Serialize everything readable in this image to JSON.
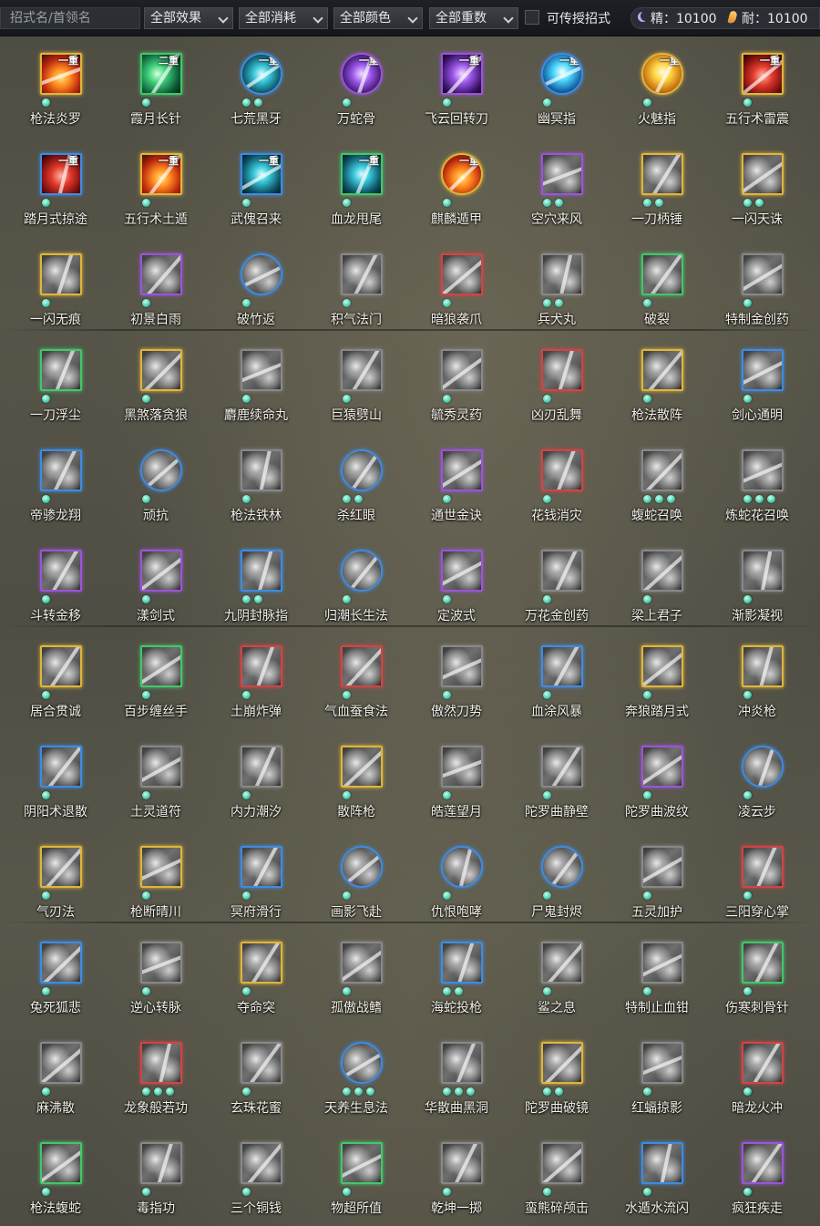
{
  "filters": {
    "search_placeholder": "招式名/首领名",
    "effect": "全部效果",
    "cost": "全部消耗",
    "color": "全部颜色",
    "weight": "全部重数",
    "transferable_label": "可传授招式"
  },
  "stats": {
    "jing_label": "精：10100",
    "nai_label": "耐：10100"
  },
  "skills": [
    {
      "name": "枪法炎罗",
      "tier": "一重",
      "border": "#e0b53a",
      "art": "fire",
      "dots": 1
    },
    {
      "name": "霞月长针",
      "tier": "二重",
      "border": "#44c66a",
      "art": "green",
      "dots": 1
    },
    {
      "name": "七荒黑牙",
      "tier": "一重",
      "border": "#3f8be0",
      "art": "teal",
      "dots": 2,
      "round": true
    },
    {
      "name": "万蛇骨",
      "tier": "一重",
      "border": "#9a55d6",
      "art": "purple",
      "dots": 1,
      "round": true
    },
    {
      "name": "飞云回转刀",
      "tier": "一重",
      "border": "#9a55d6",
      "art": "purple",
      "dots": 1
    },
    {
      "name": "幽冥指",
      "tier": "一重",
      "border": "#3f8be0",
      "art": "cyan",
      "dots": 1,
      "round": true
    },
    {
      "name": "火魅指",
      "tier": "一重",
      "border": "#e0b53a",
      "art": "gold",
      "dots": 1,
      "round": true
    },
    {
      "name": "五行术雷震",
      "tier": "一重",
      "border": "#e0b53a",
      "art": "red",
      "dots": 1
    },
    {
      "name": "踏月式掠途",
      "tier": "一重",
      "border": "#3f8be0",
      "art": "red",
      "dots": 1
    },
    {
      "name": "五行术土遁",
      "tier": "一重",
      "border": "#e0b53a",
      "art": "fire",
      "dots": 1
    },
    {
      "name": "武傀召来",
      "tier": "一重",
      "border": "#3f8be0",
      "art": "teal",
      "dots": 1
    },
    {
      "name": "血龙甩尾",
      "tier": "一重",
      "border": "#44c66a",
      "art": "teal",
      "dots": 1
    },
    {
      "name": "麒麟遁甲",
      "tier": "一重",
      "border": "#e0b53a",
      "art": "fire",
      "dots": 1,
      "round": true
    },
    {
      "name": "空穴来风",
      "tier": "",
      "border": "#9a55d6",
      "art": "gray",
      "dots": 2
    },
    {
      "name": "一刀柄锤",
      "tier": "",
      "border": "#e0b53a",
      "art": "gray",
      "dots": 2
    },
    {
      "name": "一闪天诛",
      "tier": "",
      "border": "#e0b53a",
      "art": "gray",
      "dots": 2
    },
    {
      "name": "一闪无痕",
      "tier": "",
      "border": "#e0b53a",
      "art": "gray",
      "dots": 1
    },
    {
      "name": "初景白雨",
      "tier": "",
      "border": "#9a55d6",
      "art": "gray",
      "dots": 1
    },
    {
      "name": "破竹返",
      "tier": "",
      "border": "#3f8be0",
      "art": "gray",
      "dots": 1,
      "round": true
    },
    {
      "name": "积气法门",
      "tier": "",
      "border": "#888888",
      "art": "gray",
      "dots": 1
    },
    {
      "name": "暗狼袭爪",
      "tier": "",
      "border": "#d04545",
      "art": "gray",
      "dots": 1
    },
    {
      "name": "兵犬丸",
      "tier": "",
      "border": "#888888",
      "art": "gray",
      "dots": 2
    },
    {
      "name": "破裂",
      "tier": "",
      "border": "#44c66a",
      "art": "gray",
      "dots": 1
    },
    {
      "name": "特制金创药",
      "tier": "",
      "border": "#888888",
      "art": "gray",
      "dots": 1
    },
    {
      "name": "一刀浮尘",
      "tier": "",
      "border": "#44c66a",
      "art": "gray",
      "dots": 1
    },
    {
      "name": "黑煞落贪狼",
      "tier": "",
      "border": "#e0b53a",
      "art": "gray",
      "dots": 1
    },
    {
      "name": "麝鹿续命丸",
      "tier": "",
      "border": "#888888",
      "art": "gray",
      "dots": 1
    },
    {
      "name": "巨猿劈山",
      "tier": "",
      "border": "#888888",
      "art": "gray",
      "dots": 1
    },
    {
      "name": "毓秀灵药",
      "tier": "",
      "border": "#888888",
      "art": "gray",
      "dots": 1
    },
    {
      "name": "凶刃乱舞",
      "tier": "",
      "border": "#d04545",
      "art": "gray",
      "dots": 1
    },
    {
      "name": "枪法散阵",
      "tier": "",
      "border": "#e0b53a",
      "art": "gray",
      "dots": 1
    },
    {
      "name": "剑心通明",
      "tier": "",
      "border": "#3f8be0",
      "art": "gray",
      "dots": 1
    },
    {
      "name": "帝骖龙翔",
      "tier": "",
      "border": "#3f8be0",
      "art": "gray",
      "dots": 1
    },
    {
      "name": "顽抗",
      "tier": "",
      "border": "#3f8be0",
      "art": "gray",
      "dots": 1,
      "round": true
    },
    {
      "name": "枪法铁林",
      "tier": "",
      "border": "#888888",
      "art": "gray",
      "dots": 1
    },
    {
      "name": "杀红眼",
      "tier": "",
      "border": "#3f8be0",
      "art": "gray",
      "dots": 2,
      "round": true
    },
    {
      "name": "通世金诀",
      "tier": "",
      "border": "#9a55d6",
      "art": "gray",
      "dots": 1
    },
    {
      "name": "花钱消灾",
      "tier": "",
      "border": "#d04545",
      "art": "gray",
      "dots": 1
    },
    {
      "name": "蝮蛇召唤",
      "tier": "",
      "border": "#888888",
      "art": "gray",
      "dots": 3
    },
    {
      "name": "炼蛇花召唤",
      "tier": "",
      "border": "#888888",
      "art": "gray",
      "dots": 3
    },
    {
      "name": "斗转金移",
      "tier": "",
      "border": "#9a55d6",
      "art": "gray",
      "dots": 1
    },
    {
      "name": "漾剑式",
      "tier": "",
      "border": "#9a55d6",
      "art": "gray",
      "dots": 1
    },
    {
      "name": "九阴封脉指",
      "tier": "",
      "border": "#3f8be0",
      "art": "gray",
      "dots": 2
    },
    {
      "name": "归潮长生法",
      "tier": "",
      "border": "#3f8be0",
      "art": "gray",
      "dots": 1,
      "round": true
    },
    {
      "name": "定波式",
      "tier": "",
      "border": "#9a55d6",
      "art": "gray",
      "dots": 1
    },
    {
      "name": "万花金创药",
      "tier": "",
      "border": "#888888",
      "art": "gray",
      "dots": 1
    },
    {
      "name": "梁上君子",
      "tier": "",
      "border": "#888888",
      "art": "gray",
      "dots": 1
    },
    {
      "name": "渐影凝视",
      "tier": "",
      "border": "#888888",
      "art": "gray",
      "dots": 1
    },
    {
      "name": "居合贯诚",
      "tier": "",
      "border": "#e0b53a",
      "art": "gray",
      "dots": 1
    },
    {
      "name": "百步缠丝手",
      "tier": "",
      "border": "#44c66a",
      "art": "gray",
      "dots": 1
    },
    {
      "name": "土崩炸弹",
      "tier": "",
      "border": "#d04545",
      "art": "gray",
      "dots": 1
    },
    {
      "name": "气血蚕食法",
      "tier": "",
      "border": "#d04545",
      "art": "gray",
      "dots": 1
    },
    {
      "name": "傲然刀势",
      "tier": "",
      "border": "#888888",
      "art": "gray",
      "dots": 1
    },
    {
      "name": "血涂风暴",
      "tier": "",
      "border": "#3f8be0",
      "art": "gray",
      "dots": 1
    },
    {
      "name": "奔狼踏月式",
      "tier": "",
      "border": "#e0b53a",
      "art": "gray",
      "dots": 1
    },
    {
      "name": "冲炎枪",
      "tier": "",
      "border": "#e0b53a",
      "art": "gray",
      "dots": 1
    },
    {
      "name": "阴阳术退散",
      "tier": "",
      "border": "#3f8be0",
      "art": "gray",
      "dots": 1
    },
    {
      "name": "土灵道符",
      "tier": "",
      "border": "#888888",
      "art": "gray",
      "dots": 1
    },
    {
      "name": "内力潮汐",
      "tier": "",
      "border": "#888888",
      "art": "gray",
      "dots": 1
    },
    {
      "name": "散阵枪",
      "tier": "",
      "border": "#e0b53a",
      "art": "gray",
      "dots": 1
    },
    {
      "name": "皓莲望月",
      "tier": "",
      "border": "#888888",
      "art": "gray",
      "dots": 1
    },
    {
      "name": "陀罗曲静壁",
      "tier": "",
      "border": "#888888",
      "art": "gray",
      "dots": 1
    },
    {
      "name": "陀罗曲波纹",
      "tier": "",
      "border": "#9a55d6",
      "art": "gray",
      "dots": 1
    },
    {
      "name": "凌云步",
      "tier": "",
      "border": "#3f8be0",
      "art": "gray",
      "dots": 1,
      "round": true
    },
    {
      "name": "气刃法",
      "tier": "",
      "border": "#e0b53a",
      "art": "gray",
      "dots": 1
    },
    {
      "name": "枪断晴川",
      "tier": "",
      "border": "#e0b53a",
      "art": "gray",
      "dots": 1
    },
    {
      "name": "冥府滑行",
      "tier": "",
      "border": "#3f8be0",
      "art": "gray",
      "dots": 1
    },
    {
      "name": "画影飞赴",
      "tier": "",
      "border": "#3f8be0",
      "art": "gray",
      "dots": 1,
      "round": true
    },
    {
      "name": "仇恨咆哮",
      "tier": "",
      "border": "#3f8be0",
      "art": "gray",
      "dots": 1,
      "round": true
    },
    {
      "name": "尸鬼封烬",
      "tier": "",
      "border": "#3f8be0",
      "art": "gray",
      "dots": 1,
      "round": true
    },
    {
      "name": "五灵加护",
      "tier": "",
      "border": "#888888",
      "art": "gray",
      "dots": 1
    },
    {
      "name": "三阳穿心掌",
      "tier": "",
      "border": "#d04545",
      "art": "gray",
      "dots": 1
    },
    {
      "name": "兔死狐悲",
      "tier": "",
      "border": "#3f8be0",
      "art": "gray",
      "dots": 1
    },
    {
      "name": "逆心转脉",
      "tier": "",
      "border": "#888888",
      "art": "gray",
      "dots": 1
    },
    {
      "name": "夺命突",
      "tier": "",
      "border": "#e0b53a",
      "art": "gray",
      "dots": 1
    },
    {
      "name": "孤傲战鳍",
      "tier": "",
      "border": "#888888",
      "art": "gray",
      "dots": 1
    },
    {
      "name": "海蛇投枪",
      "tier": "",
      "border": "#3f8be0",
      "art": "gray",
      "dots": 2
    },
    {
      "name": "鲨之息",
      "tier": "",
      "border": "#888888",
      "art": "gray",
      "dots": 1
    },
    {
      "name": "特制止血钳",
      "tier": "",
      "border": "#888888",
      "art": "gray",
      "dots": 1
    },
    {
      "name": "伤寒刺骨针",
      "tier": "",
      "border": "#44c66a",
      "art": "gray",
      "dots": 1
    },
    {
      "name": "麻沸散",
      "tier": "",
      "border": "#888888",
      "art": "gray",
      "dots": 1
    },
    {
      "name": "龙象般若功",
      "tier": "",
      "border": "#d04545",
      "art": "gray",
      "dots": 3
    },
    {
      "name": "玄珠花蜜",
      "tier": "",
      "border": "#888888",
      "art": "gray",
      "dots": 1
    },
    {
      "name": "天养生息法",
      "tier": "",
      "border": "#3f8be0",
      "art": "gray",
      "dots": 3,
      "round": true
    },
    {
      "name": "华散曲黑洞",
      "tier": "",
      "border": "#888888",
      "art": "gray",
      "dots": 3
    },
    {
      "name": "陀罗曲破镜",
      "tier": "",
      "border": "#e0b53a",
      "art": "gray",
      "dots": 2
    },
    {
      "name": "红蝠掠影",
      "tier": "",
      "border": "#888888",
      "art": "gray",
      "dots": 1
    },
    {
      "name": "暗龙火冲",
      "tier": "",
      "border": "#d04545",
      "art": "gray",
      "dots": 1
    },
    {
      "name": "枪法蝮蛇",
      "tier": "",
      "border": "#44c66a",
      "art": "gray",
      "dots": 1
    },
    {
      "name": "毒指功",
      "tier": "",
      "border": "#888888",
      "art": "gray",
      "dots": 1
    },
    {
      "name": "三个铜钱",
      "tier": "",
      "border": "#888888",
      "art": "gray",
      "dots": 1
    },
    {
      "name": "物超所值",
      "tier": "",
      "border": "#44c66a",
      "art": "gray",
      "dots": 1
    },
    {
      "name": "乾坤一掷",
      "tier": "",
      "border": "#888888",
      "art": "gray",
      "dots": 1
    },
    {
      "name": "蛮熊碎颅击",
      "tier": "",
      "border": "#888888",
      "art": "gray",
      "dots": 1
    },
    {
      "name": "水遁水流闪",
      "tier": "",
      "border": "#3f8be0",
      "art": "gray",
      "dots": 1
    },
    {
      "name": "疯狂疾走",
      "tier": "",
      "border": "#9a55d6",
      "art": "gray",
      "dots": 1
    }
  ]
}
